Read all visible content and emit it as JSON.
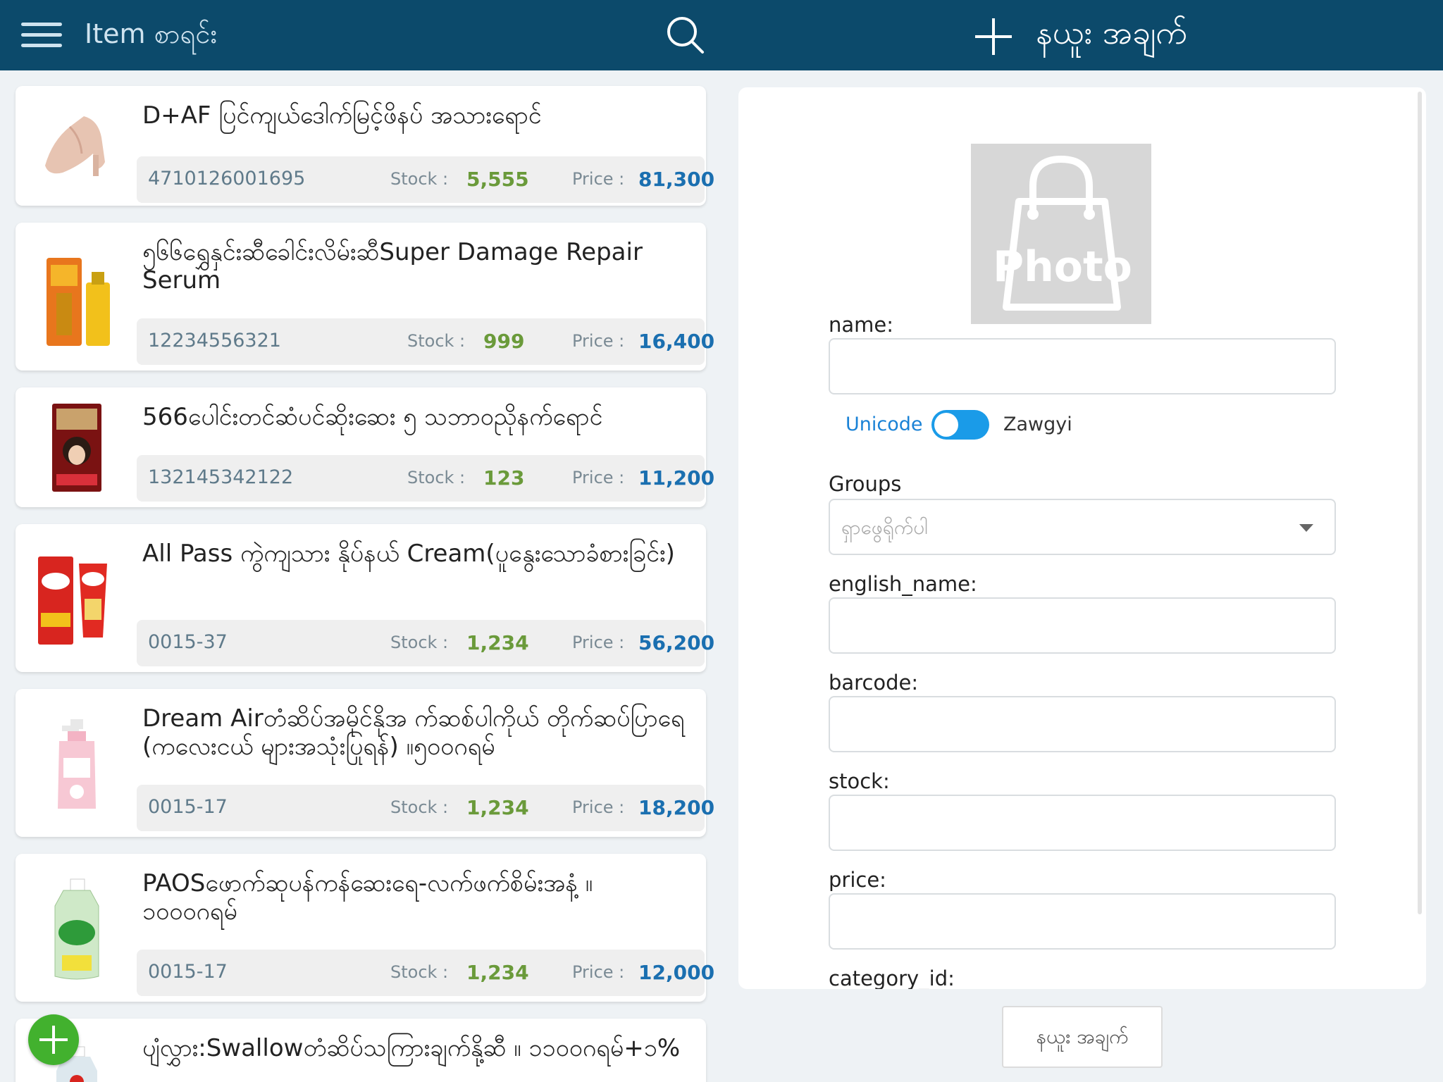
{
  "header": {
    "title": "Item စာရင်း",
    "new_item_title": "နယူး အချက်"
  },
  "items": [
    {
      "title": "D+AF ပြင်ကျယ်ဒေါက်မြင့်ဖိနပ် အသားရောင်",
      "code": "4710126001695",
      "stock_label": "Stock :",
      "stock": "5,555",
      "price_label": "Price :",
      "price": "81,300",
      "image": "beige-high-heel-shoe"
    },
    {
      "title": "၅၆၆ရွှေနှင်းဆီခေါင်းလိမ်းဆီSuper Damage Repair Serum",
      "code": "12234556321",
      "stock_label": "Stock :",
      "stock": "999",
      "price_label": "Price :",
      "price": "16,400",
      "image": "hair-serum-box-and-bottle"
    },
    {
      "title": "566ပေါင်းတင်ဆံပင်ဆိုးဆေး ၅ သဘာဝညိုနက်ရောင်",
      "code": "132145342122",
      "stock_label": "Stock :",
      "stock": "123",
      "price_label": "Price :",
      "price": "11,200",
      "image": "hair-dye-box"
    },
    {
      "title": "All Pass ကွဲကျသား နိုပ်နယ် Cream(ပူနွေးသောခံစားခြင်း)",
      "code": "0015-37",
      "stock_label": "Stock :",
      "stock": "1,234",
      "price_label": "Price :",
      "price": "56,200",
      "image": "cream-box-and-tube"
    },
    {
      "title": "Dream Airတံဆိပ်အမိုင်နိုအ က်ဆစ်ပါကိုယ် တိုက်ဆပ်ပြာရေ (ကလေးငယ် များအသုံးပြုရန်) ။၅၀၀ဂရမ်",
      "code": "0015-17",
      "stock_label": "Stock :",
      "stock": "1,234",
      "price_label": "Price :",
      "price": "18,200",
      "image": "pink-pump-bottle"
    },
    {
      "title": "PAOSဖောက်ဆုပန်ကန်ဆေးရေ-လက်ဖက်စိမ်းအနံ့ ။ ၁၀၀၀ဂရမ်",
      "code": "0015-17",
      "stock_label": "Stock :",
      "stock": "1,234",
      "price_label": "Price :",
      "price": "12,000",
      "image": "dishwashing-liquid-bottle"
    },
    {
      "title": "ပျံလွှား:Swallowတံဆိပ်သကြားချက်နို့ဆီ ။ ၁၁၀၀ဂရမ်+၁%",
      "image": "swallow-bottle"
    }
  ],
  "form": {
    "photo_text": "Photo",
    "name_label": "name:",
    "unicode_label": "Unicode",
    "zawgyi_label": "Zawgyi",
    "groups_label": "Groups",
    "groups_placeholder": "ရှာဖွေရိုက်ပါ",
    "english_name_label": "english_name:",
    "barcode_label": "barcode:",
    "stock_label": "stock:",
    "price_label": "price:",
    "category_label": "category_id:",
    "save_label": "နယူး အချက်"
  },
  "colors": {
    "topbar": "#0c4a6b",
    "stock_value": "#6a9a3a",
    "price_value": "#1a6fb0",
    "toggle": "#1a9be8",
    "fab": "#42b12e"
  }
}
